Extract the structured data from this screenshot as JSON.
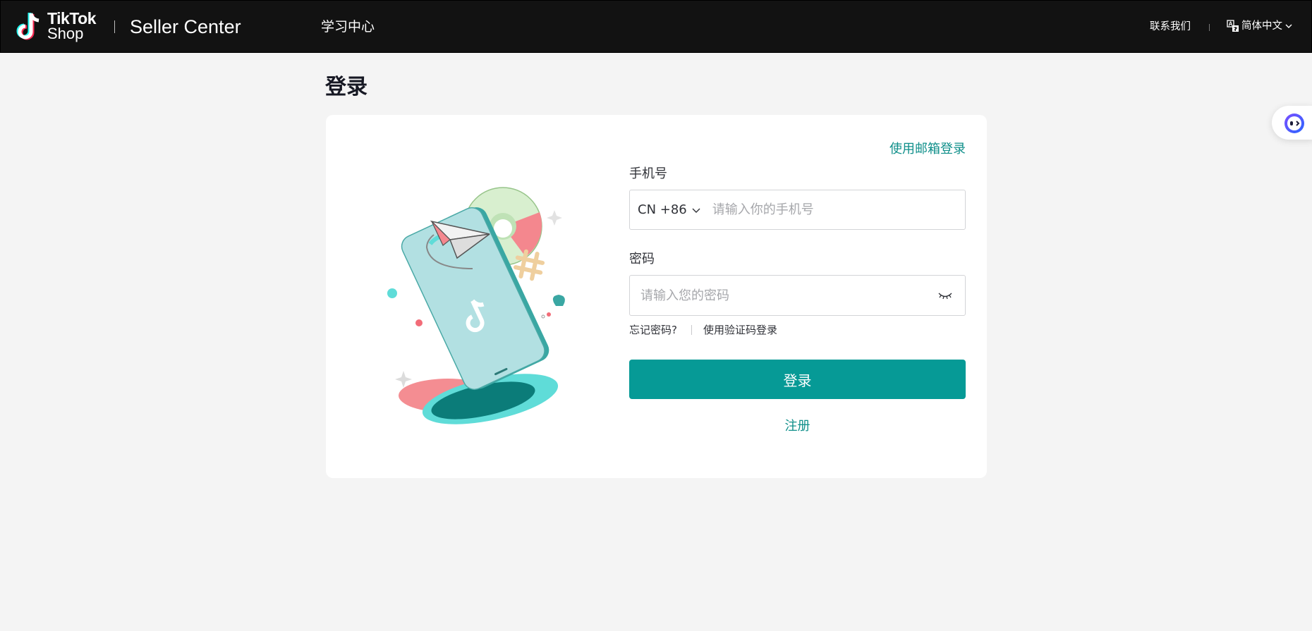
{
  "header": {
    "brand_line1": "TikTok",
    "brand_line2": "Shop",
    "product": "Seller Center",
    "nav_learning": "学习中心",
    "contact": "联系我们",
    "language": "简体中文"
  },
  "page": {
    "title": "登录"
  },
  "form": {
    "email_login_link": "使用邮箱登录",
    "phone_label": "手机号",
    "country_code": "CN +86",
    "phone_placeholder": "请输入你的手机号",
    "password_label": "密码",
    "password_placeholder": "请输入您的密码",
    "forgot_password": "忘记密码?",
    "code_login": "使用验证码登录",
    "login_button": "登录",
    "register_link": "注册"
  },
  "icons": {
    "logo": "tiktok-logo-icon",
    "language": "translate-icon",
    "chevron": "chevron-down-icon",
    "eye": "eye-closed-icon",
    "assistant": "assistant-bot-icon"
  },
  "colors": {
    "header_bg": "#121212",
    "page_bg": "#f4f4f4",
    "accent": "#069a96",
    "link": "#0f8f8a"
  }
}
